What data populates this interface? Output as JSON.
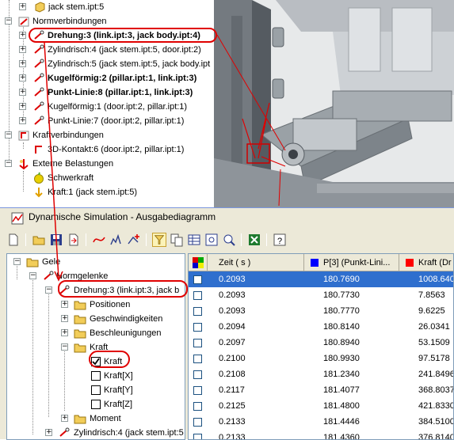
{
  "top_tree": {
    "items": [
      {
        "label": "jack stem.ipt:5",
        "bold": false
      },
      {
        "label": "Normverbindungen",
        "bold": false
      },
      {
        "label": "Drehung:3 (link.ipt:3, jack body.ipt:4)",
        "bold": true
      },
      {
        "label": "Zylindrisch:4 (jack stem.ipt:5, door.ipt:2)",
        "bold": false
      },
      {
        "label": "Zylindrisch:5 (jack stem.ipt:5, jack body.ipt",
        "bold": false
      },
      {
        "label": "Kugelförmig:2 (pillar.ipt:1, link.ipt:3)",
        "bold": true
      },
      {
        "label": "Punkt-Linie:8 (pillar.ipt:1, link.ipt:3)",
        "bold": true
      },
      {
        "label": "Kugelförmig:1 (door.ipt:2, pillar.ipt:1)",
        "bold": false
      },
      {
        "label": "Punkt-Linie:7 (door.ipt:2, pillar.ipt:1)",
        "bold": false
      },
      {
        "label": "Kraftverbindungen",
        "bold": false
      },
      {
        "label": "3D-Kontakt:6 (door.ipt:2, pillar.ipt:1)",
        "bold": false
      },
      {
        "label": "Externe Belastungen",
        "bold": false
      },
      {
        "label": "Schwerkraft",
        "bold": false
      },
      {
        "label": "Kraft:1 (jack stem.ipt:5)",
        "bold": false
      }
    ]
  },
  "dialog": {
    "title": "Dynamische Simulation - Ausgabediagramm",
    "tree": {
      "items": [
        {
          "label": "Gele"
        },
        {
          "label": "Normgelenke"
        },
        {
          "label": "Drehung:3 (link.ipt:3, jack b"
        },
        {
          "label": "Positionen"
        },
        {
          "label": "Geschwindigkeiten"
        },
        {
          "label": "Beschleunigungen"
        },
        {
          "label": "Kraft"
        },
        {
          "label": "Kraft"
        },
        {
          "label": "Kraft[X]"
        },
        {
          "label": "Kraft[Y]"
        },
        {
          "label": "Kraft[Z]"
        },
        {
          "label": "Moment"
        },
        {
          "label": "Zylindrisch:4 (jack stem.ipt:5"
        }
      ]
    },
    "grid": {
      "columns": [
        "Zeit ( s )",
        "P[3] (Punkt-Lini...",
        "Kraft (Dr"
      ],
      "series_colors": [
        "#0000ff",
        "#ff0000"
      ],
      "rows": [
        {
          "zeit": "0.2093",
          "p3": "180.7690",
          "kraft": "1008.6400"
        },
        {
          "zeit": "0.2093",
          "p3": "180.7730",
          "kraft": "7.8563"
        },
        {
          "zeit": "0.2093",
          "p3": "180.7770",
          "kraft": "9.6225"
        },
        {
          "zeit": "0.2094",
          "p3": "180.8140",
          "kraft": "26.0341"
        },
        {
          "zeit": "0.2097",
          "p3": "180.8940",
          "kraft": "53.1509"
        },
        {
          "zeit": "0.2100",
          "p3": "180.9930",
          "kraft": "97.5178"
        },
        {
          "zeit": "0.2108",
          "p3": "181.2340",
          "kraft": "241.8496"
        },
        {
          "zeit": "0.2117",
          "p3": "181.4077",
          "kraft": "368.8037"
        },
        {
          "zeit": "0.2125",
          "p3": "181.4800",
          "kraft": "421.8330"
        },
        {
          "zeit": "0.2133",
          "p3": "181.4446",
          "kraft": "384.5100"
        },
        {
          "zeit": "0.2133",
          "p3": "181.4360",
          "kraft": "376.8140"
        }
      ]
    }
  },
  "colors": {
    "callout": "#e00000",
    "selection": "#2f6fce",
    "folder": "#f2cd59"
  }
}
